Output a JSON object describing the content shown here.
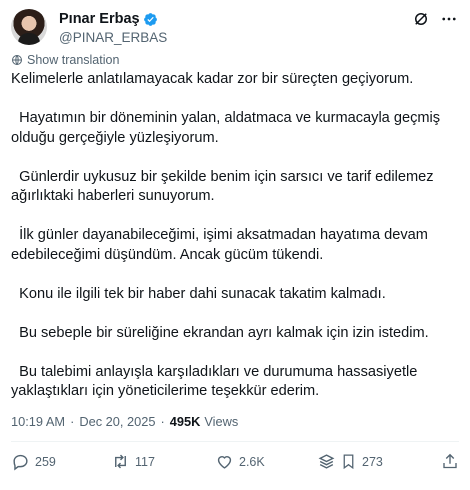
{
  "author": {
    "display_name": "Pınar Erbaş",
    "handle": "@PINAR_ERBAS"
  },
  "icons": {
    "verified": "verified-badge-icon",
    "grok": "grok-icon",
    "more": "more-icon"
  },
  "colors": {
    "verified": "#1d9bf0",
    "secondary_text": "#536471",
    "primary_text": "#0f1419"
  },
  "translate_label": "Show translation",
  "paragraphs": [
    "Kelimelerle anlatılamayacak kadar zor bir süreçten geçiyorum.",
    "  Hayatımın bir döneminin yalan, aldatmaca ve kurmacayla geçmiş olduğu gerçeğiyle yüzleşiyorum.",
    "  Günlerdir uykusuz bir şekilde benim için sarsıcı ve tarif edilemez ağırlıktaki haberleri sunuyorum.",
    "  İlk günler dayanabileceğimi, işimi aksatmadan hayatıma devam edebileceğimi düşündüm. Ancak gücüm tükendi.",
    "  Konu ile ilgili tek bir haber dahi sunacak takatim kalmadı.",
    "  Bu sebeple bir süreliğine ekrandan ayrı kalmak için izin istedim.",
    "  Bu talebimi anlayışla karşıladıkları ve durumuma hassasiyetle yaklaştıkları için yöneticilerime teşekkür ederim."
  ],
  "meta": {
    "time": "10:19 AM",
    "separator": "·",
    "date": "Dec 20, 2025",
    "views_count": "495K",
    "views_label": "Views"
  },
  "actions": {
    "replies": "259",
    "reposts": "117",
    "likes": "2.6K",
    "bookmarks": "273"
  }
}
